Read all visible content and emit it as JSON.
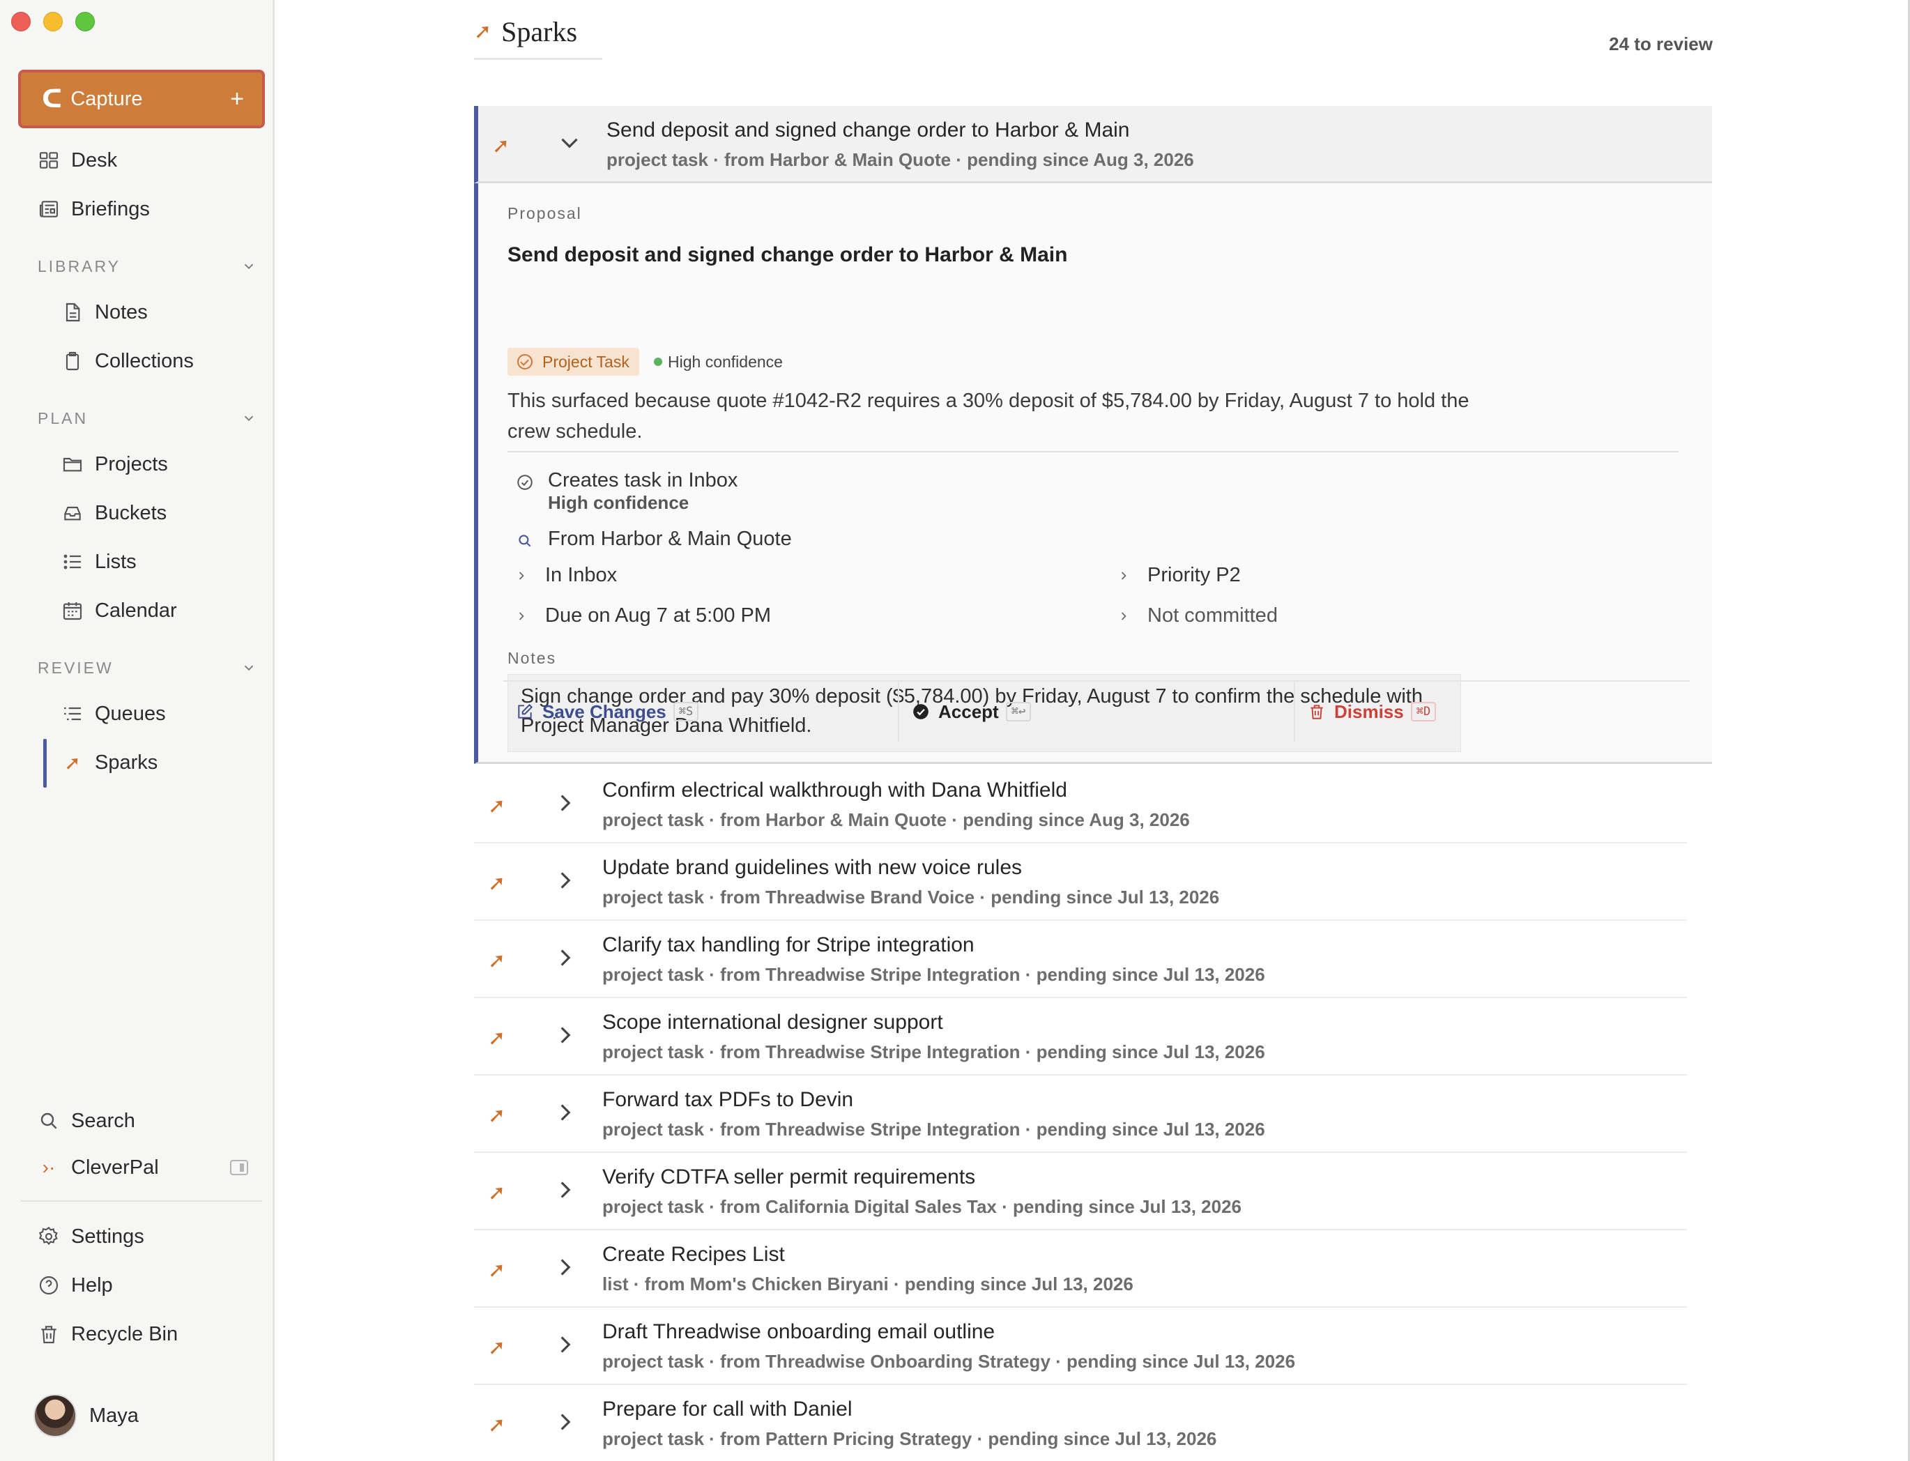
{
  "sidebar": {
    "capture": {
      "label": "Capture",
      "plus": "+"
    },
    "top_items": [
      {
        "label": "Desk",
        "icon": "grid-icon"
      },
      {
        "label": "Briefings",
        "icon": "newspaper-icon"
      }
    ],
    "sections": {
      "library": {
        "title": "LIBRARY",
        "items": [
          {
            "label": "Notes",
            "icon": "document-icon"
          },
          {
            "label": "Collections",
            "icon": "clipboard-icon"
          }
        ]
      },
      "plan": {
        "title": "PLAN",
        "items": [
          {
            "label": "Projects",
            "icon": "folder-icon"
          },
          {
            "label": "Buckets",
            "icon": "inbox-tray-icon"
          },
          {
            "label": "Lists",
            "icon": "list-icon"
          },
          {
            "label": "Calendar",
            "icon": "calendar-icon"
          }
        ]
      },
      "review": {
        "title": "REVIEW",
        "items": [
          {
            "label": "Queues",
            "icon": "queue-icon"
          },
          {
            "label": "Sparks",
            "icon": "spark-icon",
            "active": true
          }
        ]
      }
    },
    "bottom_items": [
      {
        "label": "Search",
        "icon": "search-icon"
      },
      {
        "label": "CleverPal",
        "icon": "cleverpal-icon"
      },
      {
        "label": "Settings",
        "icon": "gear-icon"
      },
      {
        "label": "Help",
        "icon": "help-icon"
      },
      {
        "label": "Recycle Bin",
        "icon": "trash-icon"
      }
    ],
    "user": {
      "name": "Maya"
    }
  },
  "header": {
    "title": "Sparks",
    "review_count": "24 to review"
  },
  "expanded": {
    "title": "Send deposit and signed change order to Harbor & Main",
    "meta": "project task · from Harbor & Main Quote · pending since Aug 3, 2026",
    "proposal_label": "Proposal",
    "proposal_title": "Send deposit and signed change order to Harbor & Main",
    "badge": "Project Task",
    "confidence": "High confidence",
    "reason": "This surfaced because quote #1042-R2 requires a 30% deposit of $5,784.00 by Friday, August 7 to hold the crew schedule.",
    "effect_title": "Creates task in Inbox",
    "effect_sub": "High confidence",
    "source": "From Harbor & Main Quote",
    "fields": {
      "location": "In Inbox",
      "priority": "Priority P2",
      "due": "Due on Aug 7 at 5:00 PM",
      "commitment": "Not committed"
    },
    "notes_label": "Notes",
    "notes": "Sign change order and pay 30% deposit ($5,784.00) by Friday, August 7 to confirm the schedule with Project Manager Dana Whitfield.",
    "actions": {
      "save": {
        "label": "Save Changes",
        "shortcut": "⌘S"
      },
      "accept": {
        "label": "Accept",
        "shortcut": "⌘↩"
      },
      "dismiss": {
        "label": "Dismiss",
        "shortcut": "⌘D"
      }
    }
  },
  "sparks": [
    {
      "title": "Confirm electrical walkthrough with Dana Whitfield",
      "meta": "project task · from Harbor & Main Quote · pending since Aug 3, 2026"
    },
    {
      "title": "Update brand guidelines with new voice rules",
      "meta": "project task · from Threadwise Brand Voice · pending since Jul 13, 2026"
    },
    {
      "title": "Clarify tax handling for Stripe integration",
      "meta": "project task · from Threadwise Stripe Integration · pending since Jul 13, 2026"
    },
    {
      "title": "Scope international designer support",
      "meta": "project task · from Threadwise Stripe Integration · pending since Jul 13, 2026"
    },
    {
      "title": "Forward tax PDFs to Devin",
      "meta": "project task · from Threadwise Stripe Integration · pending since Jul 13, 2026"
    },
    {
      "title": "Verify CDTFA seller permit requirements",
      "meta": "project task · from California Digital Sales Tax · pending since Jul 13, 2026"
    },
    {
      "title": "Create Recipes List",
      "meta": "list · from Mom's Chicken Biryani · pending since Jul 13, 2026"
    },
    {
      "title": "Draft Threadwise onboarding email outline",
      "meta": "project task · from Threadwise Onboarding Strategy · pending since Jul 13, 2026"
    },
    {
      "title": "Prepare for call with Daniel",
      "meta": "project task · from Pattern Pricing Strategy · pending since Jul 13, 2026"
    }
  ],
  "colors": {
    "accent": "#cd7c3a",
    "active_bar": "#4a5ba0",
    "danger": "#c9433a"
  }
}
